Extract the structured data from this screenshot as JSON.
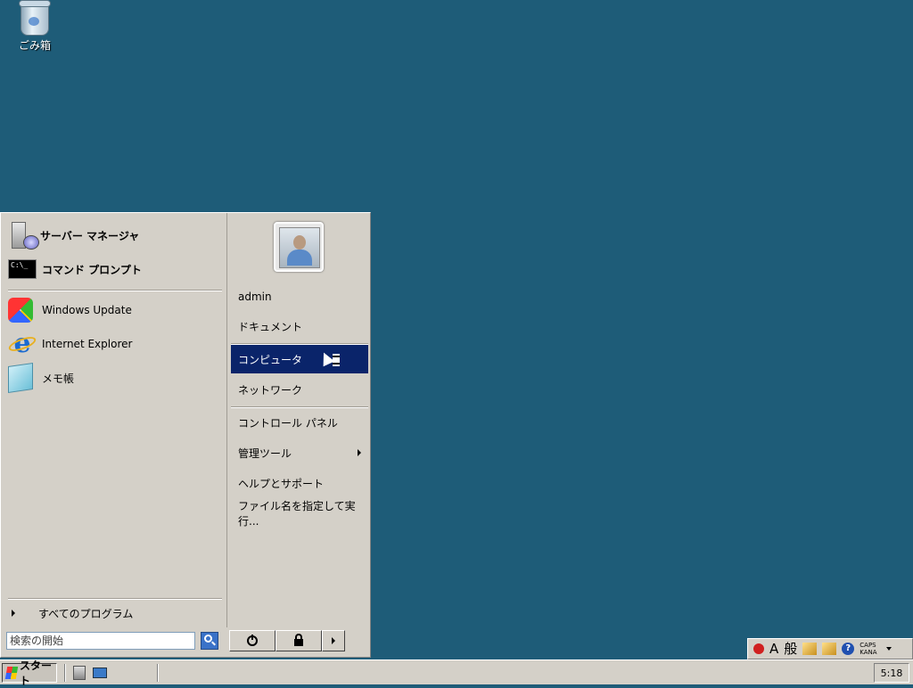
{
  "desktop": {
    "recycle_bin_label": "ごみ箱",
    "background_color": "#1e5c78"
  },
  "start_menu": {
    "pinned": [
      {
        "label": "サーバー マネージャ",
        "icon": "server-manager-icon"
      },
      {
        "label": "コマンド プロンプト",
        "icon": "command-prompt-icon"
      }
    ],
    "recent": [
      {
        "label": "Windows Update",
        "icon": "windows-update-icon"
      },
      {
        "label": "Internet Explorer",
        "icon": "internet-explorer-icon"
      },
      {
        "label": "メモ帳",
        "icon": "notepad-icon"
      }
    ],
    "all_programs_label": "すべてのプログラム",
    "search_placeholder": "検索の開始",
    "right_items": [
      {
        "label": "admin"
      },
      {
        "label": "ドキュメント"
      },
      {
        "label": "コンピュータ",
        "highlighted": true
      },
      {
        "label": "ネットワーク"
      },
      {
        "label": "コントロール パネル"
      },
      {
        "label": "管理ツール",
        "submenu": true
      },
      {
        "label": "ヘルプとサポート"
      },
      {
        "label": "ファイル名を指定して実行..."
      }
    ],
    "highlight_color": "#0a246a",
    "cmd_icon_text": "C:\\_"
  },
  "language_bar": {
    "ime_mode": "A",
    "input_mode": "般",
    "help": "?",
    "caps": "CAPS",
    "kana": "KANA"
  },
  "taskbar": {
    "start_label": "スタート",
    "clock": "5:18"
  }
}
